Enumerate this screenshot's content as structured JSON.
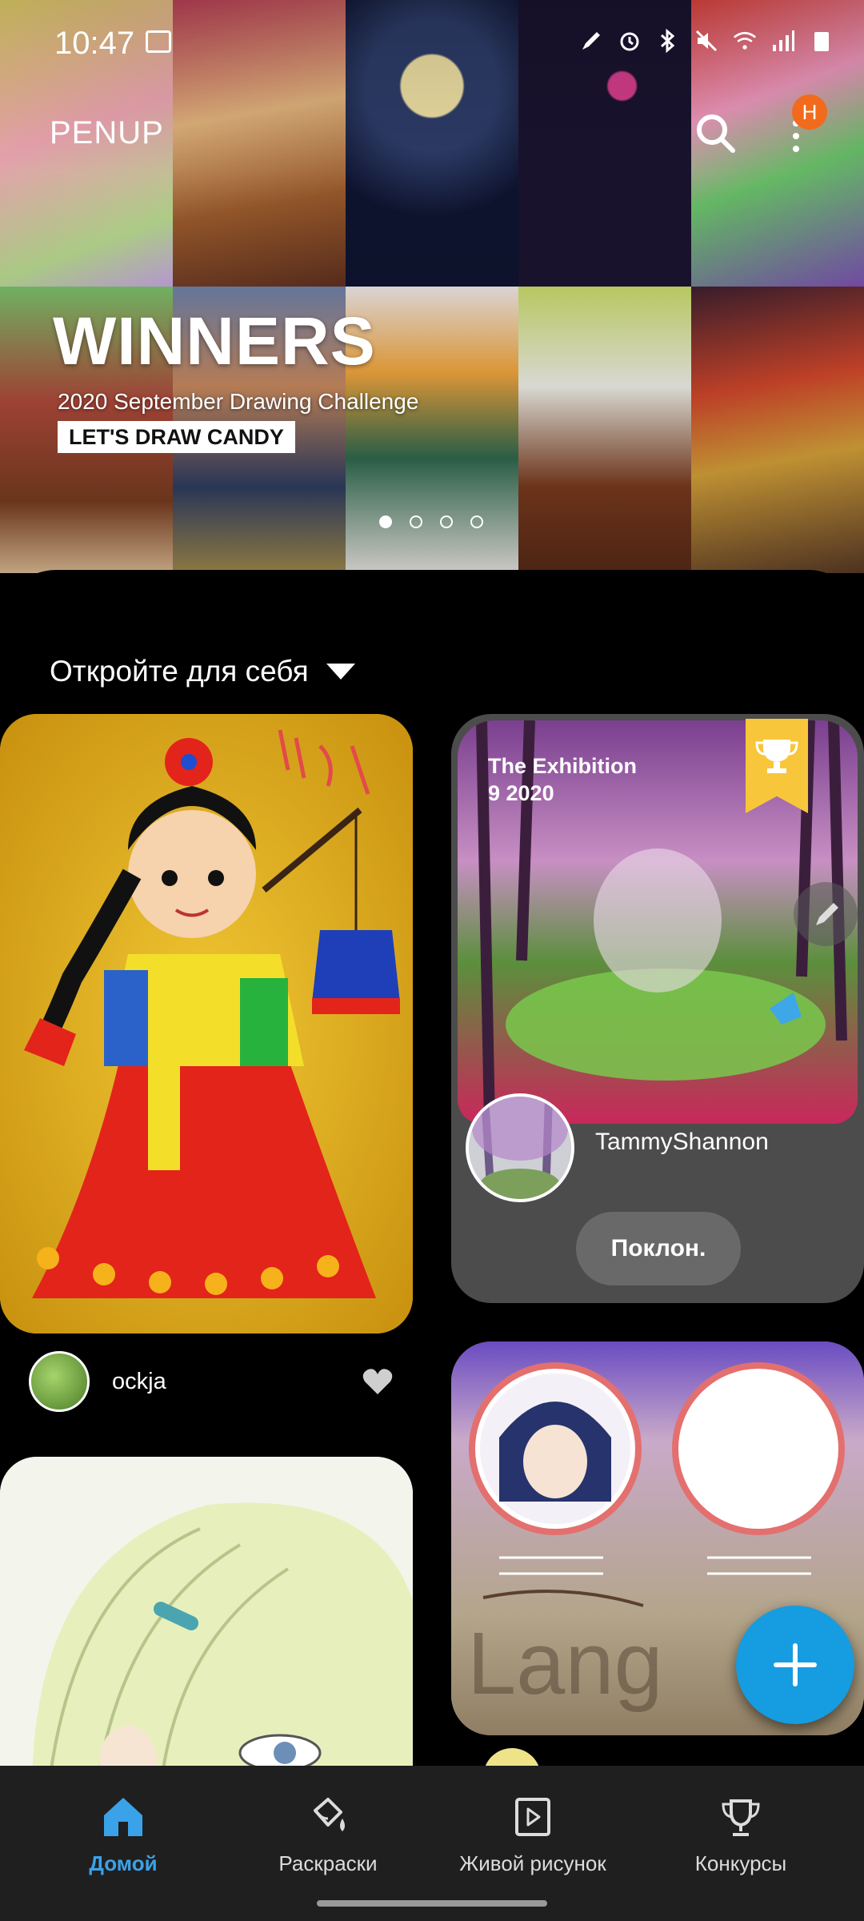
{
  "status_bar": {
    "time": "10:47"
  },
  "header": {
    "app_title": "PENUP",
    "notification_badge": "H"
  },
  "banner": {
    "title": "WINNERS",
    "subtitle": "2020 September Drawing Challenge",
    "theme": "LET'S DRAW CANDY",
    "page_count": 4,
    "active_page": 1
  },
  "feed": {
    "filter_label": "Откройте для себя",
    "posts": [
      {
        "author": "ockja"
      }
    ],
    "exhibition": {
      "title": "The Exhibition",
      "date": "9 2020",
      "artist": "TammyShannon",
      "action_label": "Поклон."
    }
  },
  "bottom_nav": {
    "items": [
      {
        "label": "Домой",
        "icon": "home-icon",
        "active": true
      },
      {
        "label": "Раскраски",
        "icon": "paint-bucket-icon",
        "active": false
      },
      {
        "label": "Живой рисунок",
        "icon": "play-icon",
        "active": false
      },
      {
        "label": "Конкурсы",
        "icon": "trophy-icon",
        "active": false
      }
    ]
  },
  "colors": {
    "accent": "#3aa2e8",
    "fab": "#169ce0",
    "badge": "#f26a1b",
    "trophy_ribbon": "#f7c63a"
  }
}
